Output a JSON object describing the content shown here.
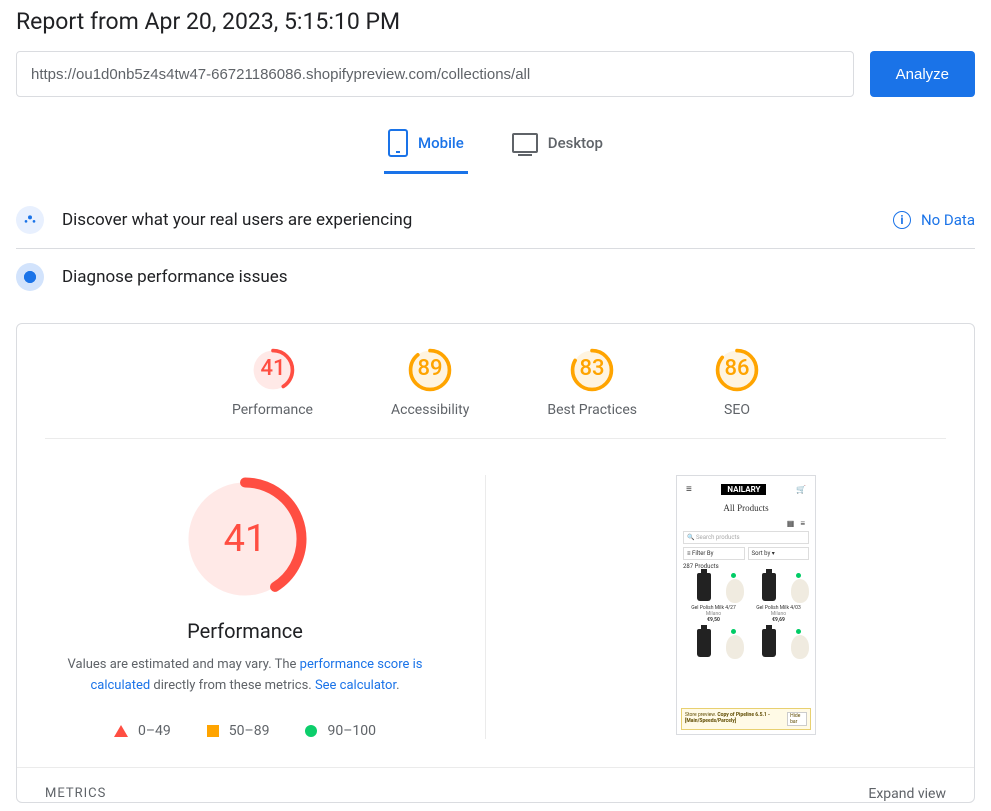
{
  "title": "Report from Apr 20, 2023, 5:15:10 PM",
  "url": "https://ou1d0nb5z4s4tw47-66721186086.shopifypreview.com/collections/all",
  "analyze_label": "Analyze",
  "tabs": {
    "mobile": "Mobile",
    "desktop": "Desktop"
  },
  "discover": {
    "title": "Discover what your real users are experiencing",
    "no_data": "No Data"
  },
  "diagnose": {
    "title": "Diagnose performance issues"
  },
  "gauges": [
    {
      "score": 41,
      "label": "Performance",
      "color": "#ff4e42",
      "bg": "#ffe9e7"
    },
    {
      "score": 89,
      "label": "Accessibility",
      "color": "#ffa400",
      "bg": "#fff4e0"
    },
    {
      "score": 83,
      "label": "Best Practices",
      "color": "#ffa400",
      "bg": "#fff4e0"
    },
    {
      "score": 86,
      "label": "SEO",
      "color": "#ffa400",
      "bg": "#fff4e0"
    }
  ],
  "big_gauge": {
    "score": 41,
    "label": "Performance",
    "color": "#ff4e42",
    "bg": "#ffe9e7"
  },
  "desc": {
    "prefix": "Values are estimated and may vary. The ",
    "link1": "performance score is calculated",
    "mid": " directly from these metrics. ",
    "link2": "See calculator",
    "suffix": "."
  },
  "legend": {
    "fail": "0–49",
    "avg": "50–89",
    "pass": "90–100"
  },
  "screenshot": {
    "logo": "NAILARY",
    "title": "All Products",
    "search": "Search products",
    "filter": "Filter By",
    "sort": "Sort by",
    "count": "287 Products",
    "products": [
      {
        "name": "Gel Polish Milk 4/27",
        "brand": "Milano",
        "price": "€9,50"
      },
      {
        "name": "Gel Polish Milk 4/03",
        "brand": "Milano",
        "price": "€9,69"
      }
    ],
    "banner_prefix": "Store preview.",
    "banner_text": "Copy of Pipeline 6.5.1 - [Main/Speeds/Parcely]",
    "banner_hide": "Hide bar"
  },
  "metrics": {
    "label": "METRICS",
    "expand": "Expand view"
  }
}
